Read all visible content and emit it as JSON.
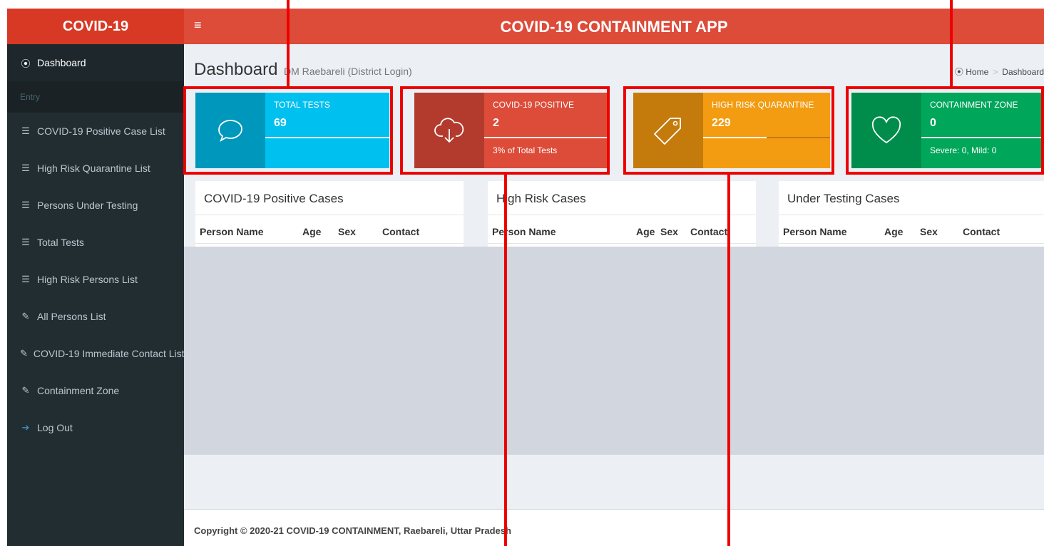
{
  "brand": {
    "logo": "COVID-19",
    "app_title": "COVID-19 CONTAINMENT APP",
    "menu_icon": "≡"
  },
  "sidebar": {
    "section_header": "Entry",
    "items": [
      {
        "label": "Dashboard",
        "icon": "⦿",
        "active": true
      },
      {
        "label": "COVID-19 Positive Case List",
        "icon": "☰"
      },
      {
        "label": "High Risk Quarantine List",
        "icon": "☰"
      },
      {
        "label": "Persons Under Testing",
        "icon": "☰"
      },
      {
        "label": "Total Tests",
        "icon": "☰"
      },
      {
        "label": "High Risk Persons List",
        "icon": "☰"
      },
      {
        "label": "All Persons List",
        "icon": "✎"
      },
      {
        "label": "COVID-19 Immediate Contact List",
        "icon": "✎"
      },
      {
        "label": "Containment Zone",
        "icon": "✎"
      },
      {
        "label": "Log Out",
        "icon": "➔"
      }
    ]
  },
  "header": {
    "title": "Dashboard",
    "subtitle": "DM Raebareli (District Login)",
    "breadcrumb_home": "Home",
    "breadcrumb_current": "Dashboard"
  },
  "info_boxes": [
    {
      "label": "TOTAL TESTS",
      "value": "69",
      "description": "",
      "progress": 1.0,
      "icon": "chat-bubble-icon",
      "color_main": "#00c0ef",
      "color_icon": "#0097bc"
    },
    {
      "label": "COVID-19 POSITIVE",
      "value": "2",
      "description": "3% of Total Tests",
      "progress": 1.0,
      "icon": "cloud-download-icon",
      "color_main": "#dd4b39",
      "color_icon": "#b33b2d"
    },
    {
      "label": "HIGH RISK QUARANTINE",
      "value": "229",
      "description": "",
      "progress": 0.5,
      "icon": "tag-icon",
      "color_main": "#f39c12",
      "color_icon": "#c47b0c"
    },
    {
      "label": "CONTAINMENT ZONE",
      "value": "0",
      "description": "Severe: 0, Mild: 0",
      "progress": 1.0,
      "icon": "heart-icon",
      "color_main": "#00a65a",
      "color_icon": "#008d4c"
    }
  ],
  "panels": [
    {
      "title": "COVID-19 Positive Cases",
      "columns": [
        "Person Name",
        "Age",
        "Sex",
        "Contact"
      ]
    },
    {
      "title": "High Risk Cases",
      "columns": [
        "Person Name",
        "Age",
        "Sex",
        "Contact"
      ]
    },
    {
      "title": "Under Testing Cases",
      "columns": [
        "Person Name",
        "Age",
        "Sex",
        "Contact"
      ]
    }
  ],
  "footer": {
    "text": "Copyright © 2020-21 COVID-19 CONTAINMENT, Raebareli, Uttar Pradesh"
  },
  "annotation_color": "#ee0000"
}
